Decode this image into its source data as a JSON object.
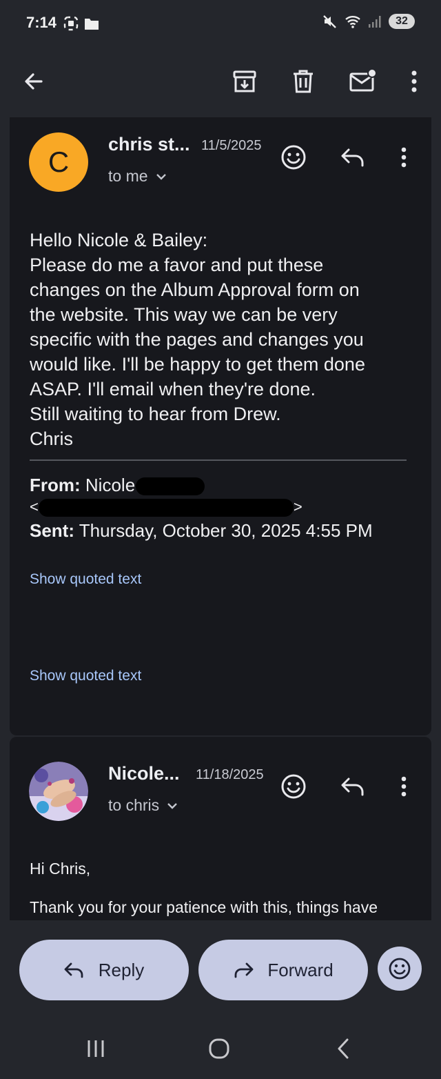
{
  "status_bar": {
    "time": "7:14",
    "battery": "32",
    "icons": [
      "screenshot-icon",
      "folder-icon",
      "mute-icon",
      "wifi-icon",
      "signal-icon",
      "battery-icon"
    ]
  },
  "toolbar": {
    "icons": [
      "back-arrow-icon",
      "archive-icon",
      "delete-icon",
      "mark-unread-icon",
      "more-vert-icon"
    ]
  },
  "messages": [
    {
      "avatar_letter": "C",
      "avatar_color": "#f9a825",
      "sender": "chris st...",
      "date": "11/5/2025",
      "recipient": "to me",
      "body_lines": [
        "Hello Nicole & Bailey:",
        "Please do me a favor and put these",
        "changes on the Album Approval form on",
        "the website. This way we can be very",
        "specific with the pages and changes you",
        "would like. I'll be happy to get them done",
        "ASAP. I'll email when they're done.",
        "Still waiting to hear from Drew.",
        "Chris"
      ],
      "from_label": "From:",
      "from_value": "Nicole",
      "email_open": "<",
      "email_close": ">",
      "sent_label": "Sent:",
      "sent_value": "Thursday, October 30, 2025 4:55 PM",
      "show_quoted_1": "Show quoted text",
      "show_quoted_2": "Show quoted text"
    },
    {
      "sender": "Nicole...",
      "date": "11/18/2025",
      "recipient": "to chris",
      "greeting": "Hi Chris,",
      "body_preview": "Thank you for your patience with this, things have"
    }
  ],
  "actions": {
    "reply": "Reply",
    "forward": "Forward"
  },
  "colors": {
    "background": "#24262c",
    "card": "#17181d",
    "pill": "#c6cbe4",
    "link": "#a8c7fa",
    "avatar": "#f9a825"
  }
}
